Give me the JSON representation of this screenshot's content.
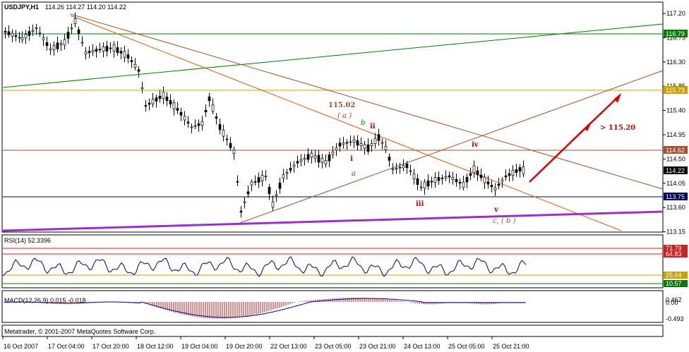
{
  "main": {
    "title": "USDJPY,H1",
    "ohlc": "114.26 114.27 114.20 114.22",
    "axis_labels": [
      "117.20",
      "116.75",
      "116.30",
      "115.85",
      "115.40",
      "114.95",
      "114.50",
      "114.05",
      "113.60",
      "113.15"
    ],
    "current_price": "114.22",
    "level_boxes": [
      {
        "label": "116.79",
        "bg": "#0a7a0a",
        "fg": "#ffffff"
      },
      {
        "label": "115.73",
        "bg": "#c8a000",
        "fg": "#ffffff"
      },
      {
        "label": "114.62",
        "bg": "#a05030",
        "fg": "#ffffff"
      },
      {
        "label": "113.75",
        "bg": "#000050",
        "fg": "#ffffff"
      }
    ],
    "annotations": {
      "peak_price": "115.02",
      "a_paren": "( a )",
      "b_lower": "b",
      "a_lower": "a",
      "ii": "ii",
      "i": "i",
      "iii": "iii",
      "iv": "iv",
      "v": "v",
      "c_b": "c, ( b )",
      "target": "> 115.20"
    }
  },
  "rsi": {
    "title": "RSI(14) 52.3396",
    "levels": [
      {
        "label": "71.79",
        "bg": "#d02020"
      },
      {
        "label": "64.83",
        "bg": "#d02020"
      },
      {
        "label": "25.64",
        "bg": "#c8a000"
      },
      {
        "label": "10.57",
        "bg": "#0a7a0a"
      }
    ]
  },
  "macd": {
    "title": "MACD(12,26,9) 0.015 -0.018",
    "axis_labels": [
      "0.462",
      "0.00",
      "-0.493"
    ]
  },
  "copyright": "Metatrader, © 2001-2007 MetaQuotes Software Corp.",
  "time_labels": [
    "16 Oct 2007",
    "17 Oct 04:00",
    "17 Oct 20:00",
    "18 Oct 12:00",
    "19 Oct 04:00",
    "19 Oct 20:00",
    "22 Oct 13:00",
    "23 Oct 05:00",
    "23 Oct 21:00",
    "24 Oct 13:00",
    "25 Oct 05:00",
    "25 Oct 21:00"
  ],
  "colors": {
    "frame": "#000000",
    "grid_green": "#008000",
    "line_orange": "#d06020",
    "line_brown": "#a06040",
    "line_purple": "#9932cc",
    "rsi_line": "#00008b",
    "macd_hist": "#b22222",
    "macd_signal": "#00008b",
    "arrow": "#e00000"
  }
}
